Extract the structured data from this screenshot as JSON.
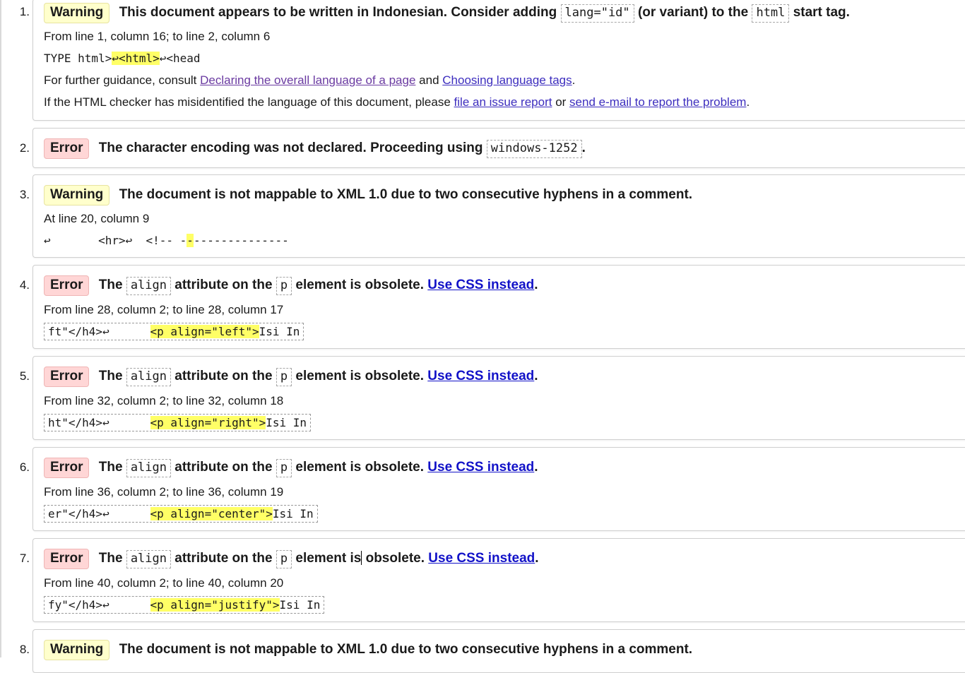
{
  "messages": [
    {
      "number": "1.",
      "type": "Warning",
      "title_pre": "This document appears to be written in Indonesian. Consider adding",
      "code1": "lang=\"id\"",
      "title_mid": "(or variant) to the",
      "code2": "html",
      "title_post": "start tag.",
      "location": "From line 1, column 16; to line 2, column 6",
      "extract_pre": "TYPE html>",
      "extract_hl": "↩<html>",
      "extract_post": "↩<head",
      "guidance_pre": "For further guidance, consult",
      "guidance_link1": "Declaring the overall language of a page",
      "guidance_and": "and",
      "guidance_link2": "Choosing language tags",
      "guidance_end": ".",
      "report_pre": "If the HTML checker has misidentified the language of this document, please",
      "report_link1": "file an issue report",
      "report_or": "or",
      "report_link2": "send e-mail to report the problem",
      "report_end": "."
    },
    {
      "number": "2.",
      "type": "Error",
      "title_pre": "The character encoding was not declared. Proceeding using",
      "code1": "windows-1252",
      "title_post": "."
    },
    {
      "number": "3.",
      "type": "Warning",
      "title": "The document is not mappable to XML 1.0 due to two consecutive hyphens in a comment.",
      "location": "At line 20, column 9",
      "extract_pre": "↩       <hr>↩  <!-- -",
      "extract_hl": "-",
      "extract_post": "--------------"
    },
    {
      "number": "4.",
      "type": "Error",
      "word_the": "The",
      "code1": "align",
      "mid": "attribute on the",
      "code2": "p",
      "post": "element is obsolete.",
      "link": "Use CSS instead",
      "end": ".",
      "location": "From line 28, column 2; to line 28, column 17",
      "extract_pre": "ft\"</h4>↩      ",
      "extract_hl": "<p align=\"left\">",
      "extract_post": "Isi In"
    },
    {
      "number": "5.",
      "type": "Error",
      "word_the": "The",
      "code1": "align",
      "mid": "attribute on the",
      "code2": "p",
      "post": "element is obsolete.",
      "link": "Use CSS instead",
      "end": ".",
      "location": "From line 32, column 2; to line 32, column 18",
      "extract_pre": "ht\"</h4>↩      ",
      "extract_hl": "<p align=\"right\">",
      "extract_post": "Isi In"
    },
    {
      "number": "6.",
      "type": "Error",
      "word_the": "The",
      "code1": "align",
      "mid": "attribute on the",
      "code2": "p",
      "post": "element is obsolete.",
      "link": "Use CSS instead",
      "end": ".",
      "location": "From line 36, column 2; to line 36, column 19",
      "extract_pre": "er\"</h4>↩      ",
      "extract_hl": "<p align=\"center\">",
      "extract_post": "Isi In"
    },
    {
      "number": "7.",
      "type": "Error",
      "word_the": "The",
      "code1": "align",
      "mid": "attribute on the",
      "code2": "p",
      "post_a": "element is",
      "post_b": "obsolete.",
      "link": "Use CSS instead",
      "end": ".",
      "location": "From line 40, column 2; to line 40, column 20",
      "extract_pre": "fy\"</h4>↩      ",
      "extract_hl": "<p align=\"justify\">",
      "extract_post": "Isi In"
    },
    {
      "number": "8.",
      "type": "Warning",
      "title": "The document is not mappable to XML 1.0 due to two consecutive hyphens in a comment."
    }
  ]
}
